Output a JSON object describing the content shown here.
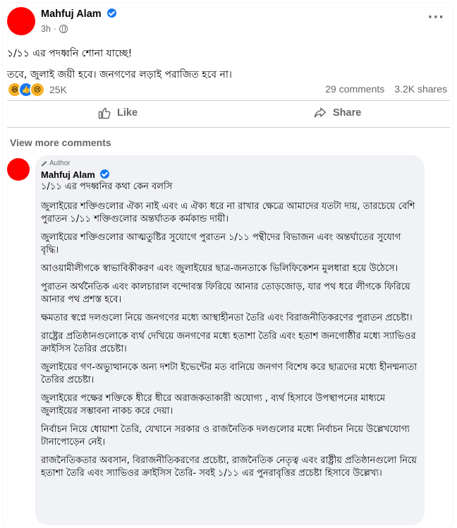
{
  "post": {
    "author": "Mahfuj Alam",
    "time": "3h",
    "time_sep": "·",
    "more_label": "···",
    "text_lines": [
      "১/১১ এর পদধ্বনি শোনা যাচ্ছে!",
      "তবে, জুলাই জয়ী হবে। জনগণের লড়াই পরাজিত হবে না।"
    ],
    "reaction_icons": [
      "haha-icon",
      "like-icon",
      "sad-icon"
    ],
    "reaction_count": "25K",
    "comments_count": "29 comments",
    "shares_count": "3.2K shares"
  },
  "actions": {
    "like_label": "Like",
    "share_label": "Share"
  },
  "comments": {
    "view_more_label": "View more comments",
    "author_badge": "Author",
    "author": "Mahfuj Alam",
    "paragraphs": [
      "১/১১ এর পদধ্বনির কথা কেন বলসি",
      "জুলাইয়ের শক্তিগুলোর ঐক্য নাই এবং এ ঐক্য ধরে না রাখার ক্ষেত্রে আমাদের যতটা দায়, তারচেয়ে বেশি পুরাতন ১/১১ শক্তিগুলোর অন্তর্ঘাতক কর্মকান্ড দায়ী।",
      "জুলাইয়ের শক্তিগুলোর আত্মতুষ্টির সুযোগে পুরাতন ১/১১ পন্থীদের বিভাজন এবং অন্তর্ঘাতের সুযোগ বৃদ্ধি।",
      "আওয়ামীলীগকে স্বাভাবিকীকরণ এবং জুলাইয়ের ছাত্র-জনতাকে ভিলিফিকেশন মুলধারা হয়ে উঠেসে।",
      "পুরাতন অর্থনৈতিক এবং কালচারাল বন্দোবস্ত ফিরিয়ে আনার তোড়জোড়, যার পথ ধরে লীগকে ফিরিয়ে আনার পথ প্রশস্ত হবে।",
      "ক্ষমতার স্বপ্নে দলগুলো নিয়ে জনগণের মধ্যে আস্থাহীনতা তৈরি এবং বিরাজনীতিকরণের পুরাতন প্রচেষ্টা।",
      "রাষ্ট্রের প্রতিষ্ঠানগুলোকে ব্যর্থ দেখিয়ে জনগণের মধ্যে হতাশা তৈরি এবং হতাশ জনগোষ্ঠীর মধ্যে স্যাভিওর ক্রাইসিস তৈরির প্রচেষ্টা।",
      "জুলাইয়ের গণ-অভ্যুত্থানকে অন্য দশটা ইভেন্টের মত বানিয়ে জনগণ বিশেষ করে ছাত্রদের মধ্যে হীনম্মন্যতা তৈরির প্রচেষ্টা।",
      "জুলাইয়ের পক্ষের শক্তিকে ধীরে ধীরে অরাজকতাকারী অযোগ্য , ব্যর্থ হিসাবে উপস্থাপনের মাধ্যমে জুলাইয়ের সম্ভাবনা নাকচ করে দেয়া।",
      "নির্বাচন নিয়ে ধোয়াশা তৈরি, যেখানে সরকার ও রাজনৈতিক দলগুলোর মধ্যে নির্বাচন নিয়ে উল্লেখযোগ্য টানাপোড়েন নেই।",
      "রাজনৈতিকতার অবসান, বিরাজনীতিকরণের প্রচেষ্টা, রাজনৈতিক নেতৃত্ব এবং রাষ্ট্রীয় প্রতিষ্ঠানগুলো নিয়ে হতাশা তৈরি এবং স্যাভিওর ক্রাইসিস তৈরি- সবই ১/১১ এর পুনরাবৃত্তির প্রচেষ্টা হিসাবে উল্লেখ্য।"
    ]
  },
  "colors": {
    "avatar": "#ff0000",
    "verified": "#1877f2",
    "muted_text": "#65676b",
    "comment_bg": "#f0f2f5"
  }
}
